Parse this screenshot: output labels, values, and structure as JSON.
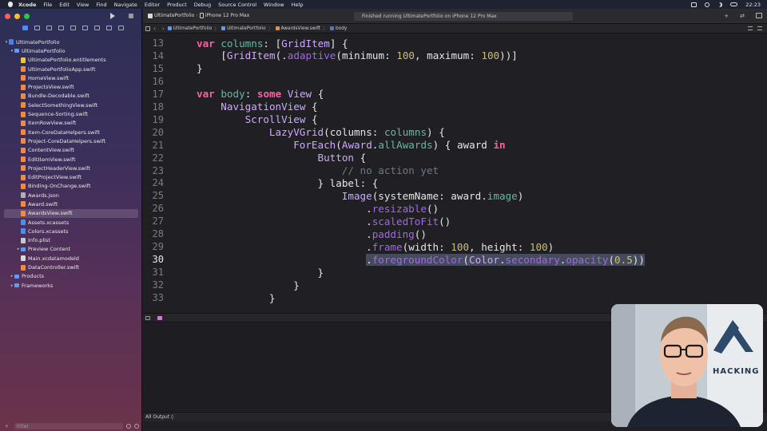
{
  "menubar": {
    "items": [
      "Xcode",
      "File",
      "Edit",
      "View",
      "Find",
      "Navigate",
      "Editor",
      "Product",
      "Debug",
      "Source Control",
      "Window",
      "Help"
    ],
    "clock": "22:23"
  },
  "toolbar": {
    "scheme": "UltimatePortfolio",
    "device": "iPhone 12 Pro Max",
    "status": "Finished running UltimatePortfolio on iPhone 12 Pro Max",
    "add": "+",
    "swap": "⇄"
  },
  "jumpbar": {
    "crumbs": [
      "UltimatePortfolio",
      "UltimatePortfolio",
      "AwardsView.swift",
      "body"
    ]
  },
  "navigator": {
    "project": "UltimatePortfolio",
    "group": "UltimatePortfolio",
    "files": [
      {
        "name": "UltimatePortfolio.entitlements",
        "kind": "ent"
      },
      {
        "name": "UltimatePortfolioApp.swift",
        "kind": "swift"
      },
      {
        "name": "HomeView.swift",
        "kind": "swift"
      },
      {
        "name": "ProjectsView.swift",
        "kind": "swift"
      },
      {
        "name": "Bundle-Decodable.swift",
        "kind": "swift"
      },
      {
        "name": "SelectSomethingView.swift",
        "kind": "swift"
      },
      {
        "name": "Sequence-Sorting.swift",
        "kind": "swift"
      },
      {
        "name": "ItemRowView.swift",
        "kind": "swift"
      },
      {
        "name": "Item-CoreDataHelpers.swift",
        "kind": "swift"
      },
      {
        "name": "Project-CoreDataHelpers.swift",
        "kind": "swift"
      },
      {
        "name": "ContentView.swift",
        "kind": "swift"
      },
      {
        "name": "EditItemView.swift",
        "kind": "swift"
      },
      {
        "name": "ProjectHeaderView.swift",
        "kind": "swift"
      },
      {
        "name": "EditProjectView.swift",
        "kind": "swift"
      },
      {
        "name": "Binding-OnChange.swift",
        "kind": "swift"
      },
      {
        "name": "Awards.json",
        "kind": "json"
      },
      {
        "name": "Award.swift",
        "kind": "swift"
      },
      {
        "name": "AwardsView.swift",
        "kind": "swift",
        "selected": true
      },
      {
        "name": "Assets.xcassets",
        "kind": "assets"
      },
      {
        "name": "Colors.xcassets",
        "kind": "assets"
      },
      {
        "name": "Info.plist",
        "kind": "plist"
      },
      {
        "name": "Preview Content",
        "kind": "folder",
        "disclosure": true
      },
      {
        "name": "Main.xcdatamodeld",
        "kind": "model"
      },
      {
        "name": "DataController.swift",
        "kind": "swift"
      }
    ],
    "top_groups": [
      "Products",
      "Frameworks"
    ],
    "filter_placeholder": "Filter",
    "add_label": "+"
  },
  "code": {
    "current_line": 30,
    "lines": [
      {
        "n": "13",
        "indent": 0,
        "tokens": [
          [
            "kw",
            "var"
          ],
          [
            "pl",
            " "
          ],
          [
            "fn",
            "columns"
          ],
          [
            "pl",
            ": ["
          ],
          [
            "ty",
            "GridItem"
          ],
          [
            "pl",
            "] {"
          ]
        ]
      },
      {
        "n": "14",
        "indent": 1,
        "tokens": [
          [
            "pl",
            "["
          ],
          [
            "ty",
            "GridItem"
          ],
          [
            "pl",
            "(."
          ],
          [
            "pr",
            "adaptive"
          ],
          [
            "pl",
            "(minimum: "
          ],
          [
            "num",
            "100"
          ],
          [
            "pl",
            ", maximum: "
          ],
          [
            "num",
            "100"
          ],
          [
            "pl",
            "))]"
          ]
        ]
      },
      {
        "n": "15",
        "indent": 0,
        "tokens": [
          [
            "pl",
            "}"
          ]
        ]
      },
      {
        "n": "16",
        "indent": 0,
        "tokens": []
      },
      {
        "n": "17",
        "indent": 0,
        "tokens": [
          [
            "kw",
            "var"
          ],
          [
            "pl",
            " "
          ],
          [
            "fn",
            "body"
          ],
          [
            "pl",
            ": "
          ],
          [
            "kw",
            "some"
          ],
          [
            "pl",
            " "
          ],
          [
            "ty",
            "View"
          ],
          [
            "pl",
            " {"
          ]
        ]
      },
      {
        "n": "18",
        "indent": 1,
        "tokens": [
          [
            "ty",
            "NavigationView"
          ],
          [
            "pl",
            " {"
          ]
        ]
      },
      {
        "n": "19",
        "indent": 2,
        "tokens": [
          [
            "ty",
            "ScrollView"
          ],
          [
            "pl",
            " {"
          ]
        ]
      },
      {
        "n": "20",
        "indent": 3,
        "tokens": [
          [
            "ty",
            "LazyVGrid"
          ],
          [
            "pl",
            "(columns: "
          ],
          [
            "fn",
            "columns"
          ],
          [
            "pl",
            ") {"
          ]
        ]
      },
      {
        "n": "21",
        "indent": 4,
        "tokens": [
          [
            "ty",
            "ForEach"
          ],
          [
            "pl",
            "("
          ],
          [
            "ty",
            "Award"
          ],
          [
            "pl",
            "."
          ],
          [
            "fn",
            "allAwards"
          ],
          [
            "pl",
            ") { award "
          ],
          [
            "kw",
            "in"
          ]
        ]
      },
      {
        "n": "22",
        "indent": 5,
        "tokens": [
          [
            "ty",
            "Button"
          ],
          [
            "pl",
            " {"
          ]
        ]
      },
      {
        "n": "23",
        "indent": 6,
        "tokens": [
          [
            "cm",
            "// no action yet"
          ]
        ]
      },
      {
        "n": "24",
        "indent": 5,
        "tokens": [
          [
            "pl",
            "} label: {"
          ]
        ]
      },
      {
        "n": "25",
        "indent": 6,
        "tokens": [
          [
            "ty",
            "Image"
          ],
          [
            "pl",
            "(systemName: award."
          ],
          [
            "fn",
            "image"
          ],
          [
            "pl",
            ")"
          ]
        ]
      },
      {
        "n": "26",
        "indent": 7,
        "tokens": [
          [
            "pl",
            "."
          ],
          [
            "pr",
            "resizable"
          ],
          [
            "pl",
            "()"
          ]
        ]
      },
      {
        "n": "27",
        "indent": 7,
        "tokens": [
          [
            "pl",
            "."
          ],
          [
            "pr",
            "scaledToFit"
          ],
          [
            "pl",
            "()"
          ]
        ]
      },
      {
        "n": "28",
        "indent": 7,
        "tokens": [
          [
            "pl",
            "."
          ],
          [
            "pr",
            "padding"
          ],
          [
            "pl",
            "()"
          ]
        ]
      },
      {
        "n": "29",
        "indent": 7,
        "tokens": [
          [
            "pl",
            "."
          ],
          [
            "pr",
            "frame"
          ],
          [
            "pl",
            "(width: "
          ],
          [
            "num",
            "100"
          ],
          [
            "pl",
            ", height: "
          ],
          [
            "num",
            "100"
          ],
          [
            "pl",
            ")"
          ]
        ]
      },
      {
        "n": "30",
        "indent": 7,
        "highlight": true,
        "tokens": [
          [
            "pl",
            "."
          ],
          [
            "pr",
            "foregroundColor"
          ],
          [
            "pl",
            "("
          ],
          [
            "ty",
            "Color"
          ],
          [
            "pl",
            "."
          ],
          [
            "pr",
            "secondary"
          ],
          [
            "pl",
            "."
          ],
          [
            "pr",
            "opacity"
          ],
          [
            "pl",
            "("
          ],
          [
            "num",
            "0.5"
          ],
          [
            "pl",
            "))"
          ]
        ]
      },
      {
        "n": "31",
        "indent": 5,
        "tokens": [
          [
            "pl",
            "}"
          ]
        ]
      },
      {
        "n": "32",
        "indent": 4,
        "tokens": [
          [
            "pl",
            "}"
          ]
        ]
      },
      {
        "n": "33",
        "indent": 3,
        "tokens": [
          [
            "pl",
            "}"
          ]
        ]
      }
    ]
  },
  "console": {
    "output_selector": "All Output ◊"
  },
  "webcam": {
    "backdrop_text": "HACKING"
  },
  "colors": {
    "keyword": "#fc5fa3",
    "type": "#d0a8ff",
    "function": "#67b7a4",
    "property": "#a167e6",
    "number": "#d0bf69",
    "comment": "#6c7986"
  }
}
